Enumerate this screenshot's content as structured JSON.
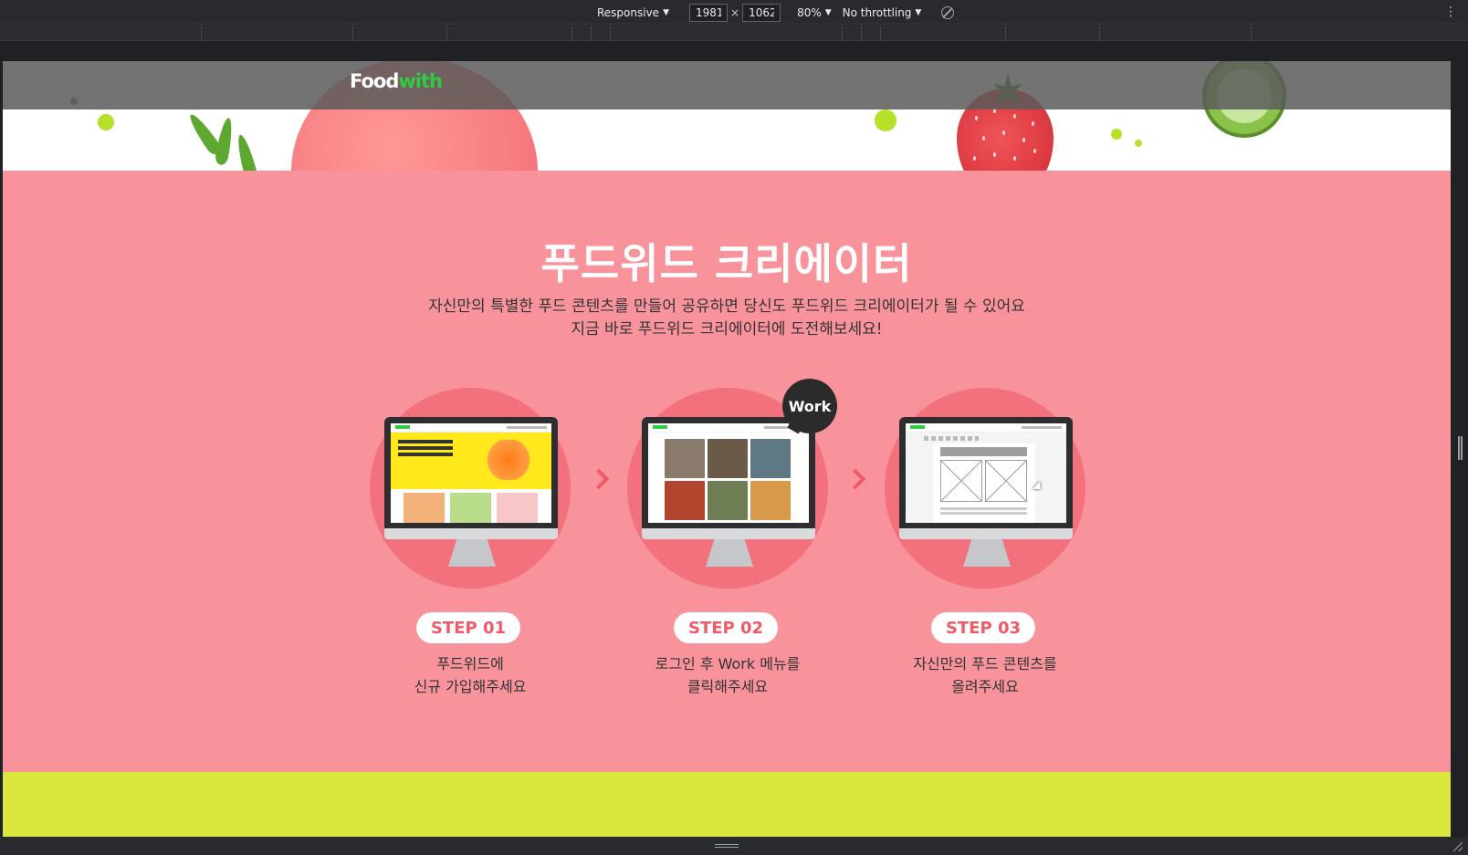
{
  "devtools": {
    "device_mode": "Responsive",
    "width": "1981",
    "height": "1062",
    "times": "×",
    "zoom": "80%",
    "throttling": "No throttling",
    "more": "⋮"
  },
  "site": {
    "logo_part1": "Food",
    "logo_part2": "with"
  },
  "creator": {
    "title": "푸드위드 크리에이터",
    "desc_line1": "자신만의 특별한 푸드 콘텐츠를 만들어 공유하면 당신도 푸드위드 크리에이터가 될 수 있어요",
    "desc_line2": "지금 바로 푸드위드 크리에이터에 도전해보세요!",
    "work_badge": "Work",
    "steps": [
      {
        "label": "STEP 01",
        "line1": "푸드위드에",
        "line2": "신규 가입해주세요"
      },
      {
        "label": "STEP 02",
        "line1": "로그인 후 Work 메뉴를",
        "line2": "클릭해주세요"
      },
      {
        "label": "STEP 03",
        "line1": "자신만의 푸드 콘텐츠를",
        "line2": "올려주세요"
      }
    ]
  },
  "colors": {
    "pink_bg": "#f8939b",
    "pink_circle": "#f2717c",
    "accent": "#f05a66",
    "lime": "#d8e63e",
    "logo_green": "#2ecc40"
  }
}
